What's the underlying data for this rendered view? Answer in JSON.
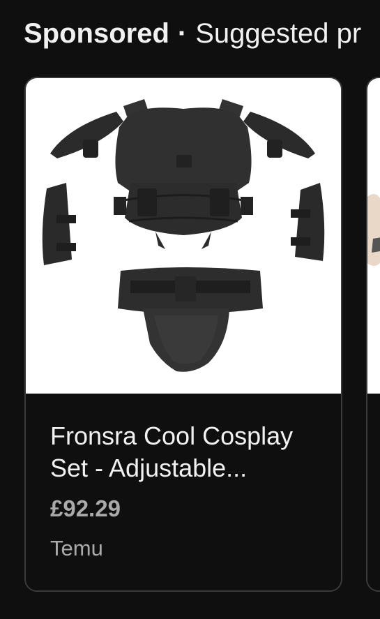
{
  "header": {
    "sponsored": "Sponsored",
    "separator": "·",
    "suggested": "Suggested pr"
  },
  "cards": [
    {
      "title": "Fronsra Cool Cosplay Set - Adjustable...",
      "price": "£92.29",
      "seller": "Temu",
      "image_icon": "tactical-armor-set-image"
    }
  ],
  "colors": {
    "background": "#0f0f0f",
    "card_border": "#3a3a3a",
    "text_primary": "#f1f1f1",
    "text_secondary": "#aaaaaa",
    "product_black": "#2a2a2a"
  }
}
